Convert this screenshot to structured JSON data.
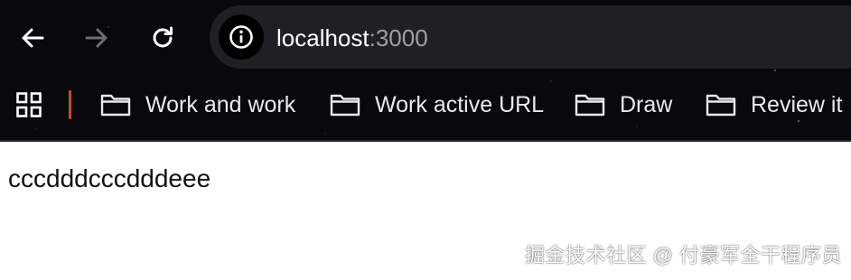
{
  "toolbar": {
    "back_icon": "arrow-left-icon",
    "forward_icon": "arrow-right-icon",
    "reload_icon": "reload-icon",
    "info_icon": "info-icon"
  },
  "address_bar": {
    "host": "localhost",
    "port": ":3000"
  },
  "bookmarks": {
    "apps_icon": "apps-grid-icon",
    "items": [
      {
        "label": "Work and work",
        "icon": "folder-icon"
      },
      {
        "label": "Work active URL",
        "icon": "folder-icon"
      },
      {
        "label": "Draw",
        "icon": "folder-icon"
      },
      {
        "label": "Review it",
        "icon": "folder-icon"
      }
    ]
  },
  "page": {
    "content": "cccdddcccdddeee"
  },
  "watermark": {
    "text": "掘金技术社区 @ 付豪军全干程序员"
  },
  "colors": {
    "chrome_bg": "#08090c",
    "omnibox_bg": "#1f2024",
    "divider_accent": "#c1502e",
    "port_text": "#9aa0a6"
  }
}
